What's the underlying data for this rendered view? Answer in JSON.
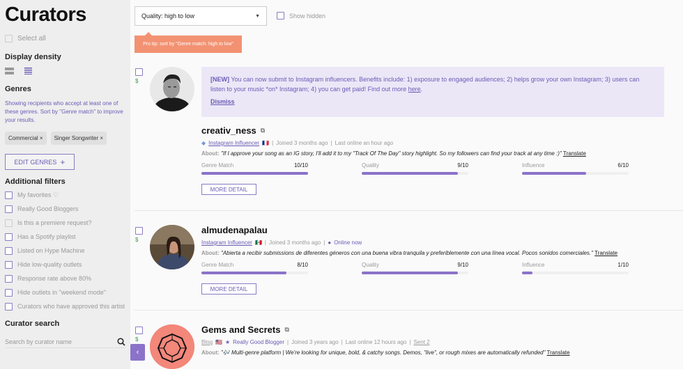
{
  "sidebar": {
    "title": "Curators",
    "select_all": "Select all",
    "display_density": "Display density",
    "genres_heading": "Genres",
    "genres_desc": "Showing recipients who accept at least one of these genres. Sort by \"Genre match\" to improve your results.",
    "genres": [
      "Commercial",
      "Singer Songwriter"
    ],
    "edit_genres": "EDIT GENRES",
    "additional_filters": "Additional filters",
    "filters": [
      {
        "label": "My favorites ♡",
        "disabled": false
      },
      {
        "label": "Really Good Bloggers",
        "disabled": false
      },
      {
        "label": "Is this a premiere request?",
        "disabled": true
      },
      {
        "label": "Has a Spotify playlist",
        "disabled": false
      },
      {
        "label": "Listed on Hype Machine",
        "disabled": false
      },
      {
        "label": "Hide low-quality outlets",
        "disabled": false
      },
      {
        "label": "Response rate above 80%",
        "disabled": false
      },
      {
        "label": "Hide outlets in \"weekend mode\"",
        "disabled": false
      },
      {
        "label": "Curators who have approved this artist",
        "disabled": false
      }
    ],
    "curator_search": "Curator search",
    "search_placeholder": "Search by curator name"
  },
  "toolbar": {
    "sort_value": "Quality: high to low",
    "show_hidden": "Show hidden",
    "protip": "Pro tip: sort by \"Genre match: high to low\""
  },
  "notice": {
    "new_tag": "[NEW]",
    "text": " You can now submit to Instagram influencers. Benefits include: 1) exposure to engaged audiences; 2) helps grow your own Instagram; 3) users can listen to your music *on* Instagram; 4) you can get paid! Find out more ",
    "link": "here",
    "dismiss": "Dismiss"
  },
  "labels": {
    "about": "About:",
    "translate": "Translate",
    "genre_match": "Genre Match",
    "quality": "Quality",
    "influence": "Influence",
    "more_detail": "MORE DETAIL",
    "dollar": "$"
  },
  "curators": [
    {
      "name": "creativ_ness",
      "role": "Instagram Influencer",
      "flag": "🇫🇷",
      "joined": "Joined 3 months ago",
      "status": "Last online an hour ago",
      "about": "\"If I approve your song as an IG story, I'll add it to my \"Track Of The Day\" story highlight. So my followers can find your track at any time :)\"",
      "genre_match": "10/10",
      "genre_match_pct": 1.0,
      "quality": "9/10",
      "quality_pct": 0.9,
      "influence": "6/10",
      "influence_pct": 0.6
    },
    {
      "name": "almudenapalau",
      "role": "Instagram Influencer",
      "flag": "🇲🇽",
      "joined": "Joined 3 months ago",
      "status": "Online now",
      "about": "\"Abierta a recibir submissions de diferentes géneros con una buena vibra tranquila y preferiblemente con una línea vocal. Pocos sonidos comerciales.\"",
      "genre_match": "8/10",
      "genre_match_pct": 0.8,
      "quality": "9/10",
      "quality_pct": 0.9,
      "influence": "1/10",
      "influence_pct": 0.1
    },
    {
      "name": "Gems and Secrets",
      "role": "Blog",
      "flag": "🇺🇸",
      "badge": "Really Good Blogger",
      "joined": "Joined 3 years ago",
      "status": "Last online 12 hours ago",
      "sent": "Sent 2",
      "about": "\"🎶 Multi-genre platform | We're looking for unique, bold, & catchy songs. Demos, \"live\", or rough mixes are automatically refunded\""
    }
  ],
  "colors": {
    "accent": "#8b73c9",
    "protip": "#f29272",
    "notice_bg": "#ebe7f7",
    "gem_bg": "#f2877a"
  }
}
